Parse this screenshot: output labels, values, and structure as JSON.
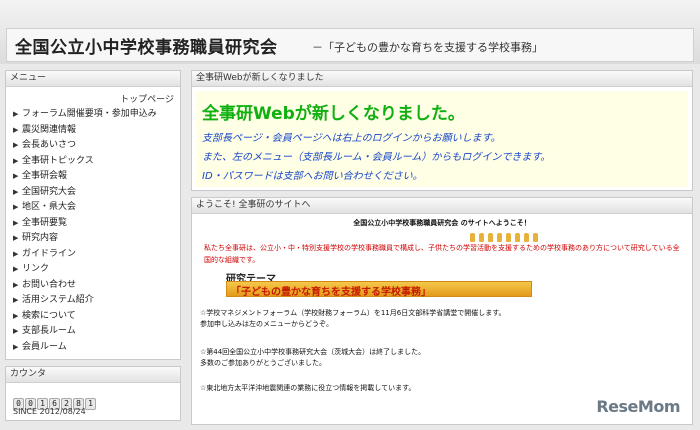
{
  "header": {
    "title": "全国公立小中学校事務職員研究会",
    "tagline": "－「子どもの豊かな育ちを支援する学校事務」"
  },
  "menu": {
    "heading": "メニュー",
    "top_page": "トップページ",
    "items": [
      "フォーラム開催要項・参加申込み",
      "震災関連情報",
      "会長あいさつ",
      "全事研トピックス",
      "全事研会報",
      "全国研究大会",
      "地区・県大会",
      "全事研要覧",
      "研究内容",
      "ガイドライン",
      "リンク",
      "お問い合わせ",
      "活用システム紹介",
      "検索について",
      "支部長ルーム",
      "会員ルーム"
    ]
  },
  "counter": {
    "heading": "カウンタ",
    "digits": [
      "0",
      "0",
      "1",
      "6",
      "2",
      "8",
      "1"
    ],
    "since": "SINCE 2012/08/24"
  },
  "notice": {
    "heading_bar": "全事研Webが新しくなりました",
    "headline": "全事研Webが新しくなりました。",
    "lines": [
      "支部長ページ・会員ページへは右上のログインからお願いします。",
      "また、左のメニュー（支部長ルーム・会員ルーム）からもログインできます。",
      "ID・パスワードは支部へお問い合わせください。"
    ]
  },
  "welcome": {
    "heading_bar": "ようこそ! 全事研のサイトへ",
    "banner": "全国公立小中学校事務職員研究会 のサイトへようこそ！",
    "intro": "私たち全事研は、公立小・中・特別支援学校の学校事務職員で構成し、子供たちの学習活動を支援するための学校事務のあり方について研究している全国的な組織です。",
    "theme_label": "研究テーマ",
    "theme": "「子どもの豊かな育ちを支援する学校事務」",
    "news": [
      [
        "☆学校マネジメントフォーラム（学校財務フォーラム）を11月6日文部科学省講堂で開催します。",
        "参加申し込みは左のメニューからどうぞ。"
      ],
      [
        "☆第44回全国公立小中学校事務研究大会（茨城大会）は終了しました。",
        "多数のご参加ありがとうございました。"
      ],
      [
        "☆東北地方太平洋沖地震関連の業務に役立つ情報を掲載しています。"
      ]
    ]
  },
  "watermark": "ReseMom"
}
